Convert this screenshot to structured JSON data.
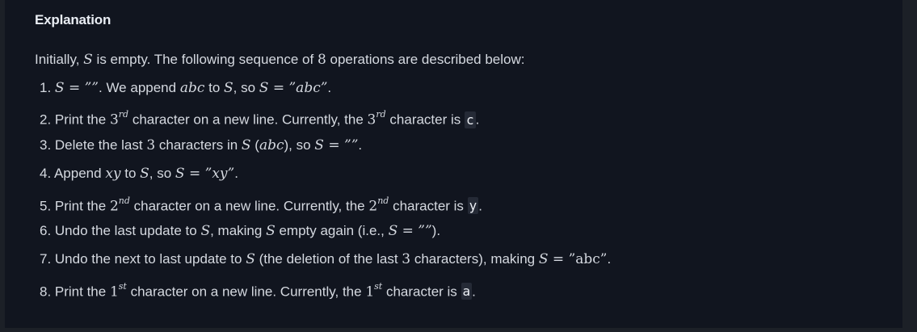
{
  "heading": "Explanation",
  "intro": {
    "t1": "Initially, ",
    "S": "S",
    "t2": " is empty. The following sequence of ",
    "n": "8",
    "t3": " operations are described below:"
  },
  "steps": [
    {
      "num": "1. ",
      "parts": {
        "a": "S",
        "b": " = ””",
        "c": ". We append ",
        "d": "abc",
        "e": " to ",
        "f": "S",
        "g": ", so ",
        "h": "S",
        "i": " = ”abc”",
        "j": "."
      }
    },
    {
      "num": "2. ",
      "parts": {
        "a": "Print the ",
        "b": "3",
        "c": "rd",
        "d": " character on a new line. Currently, the ",
        "e": "3",
        "f": "rd",
        "g": " character is ",
        "h": "c",
        "i": "."
      }
    },
    {
      "num": "3. ",
      "parts": {
        "a": "Delete the last ",
        "b": "3",
        "c": " characters in ",
        "d": "S",
        "e": " (",
        "f": "abc",
        "g": "), so ",
        "h": "S",
        "i": " = ””",
        "j": "."
      }
    },
    {
      "num": "4. ",
      "parts": {
        "a": "Append ",
        "b": "xy",
        "c": " to ",
        "d": "S",
        "e": ", so ",
        "f": "S",
        "g": " = ”xy”",
        "h": "."
      }
    },
    {
      "num": "5. ",
      "parts": {
        "a": "Print the ",
        "b": "2",
        "c": "nd",
        "d": " character on a new line. Currently, the ",
        "e": "2",
        "f": "nd",
        "g": " character is ",
        "h": "y",
        "i": "."
      }
    },
    {
      "num": "6. ",
      "parts": {
        "a": "Undo the last update to ",
        "b": "S",
        "c": ", making ",
        "d": "S",
        "e": " empty again (i.e., ",
        "f": "S",
        "g": " = ””",
        "h": ")."
      }
    },
    {
      "num": "7. ",
      "parts": {
        "a": "Undo the next to last update to ",
        "b": "S",
        "c": " (the deletion of the last ",
        "d": "3",
        "e": " characters), making ",
        "f": "S",
        "g": " = ”abc”",
        "h": "."
      }
    },
    {
      "num": "8. ",
      "parts": {
        "a": "Print the ",
        "b": "1",
        "c": "st",
        "d": " character on a new line. Currently, the ",
        "e": "1",
        "f": "st",
        "g": " character is ",
        "h": "a",
        "i": "."
      }
    }
  ]
}
